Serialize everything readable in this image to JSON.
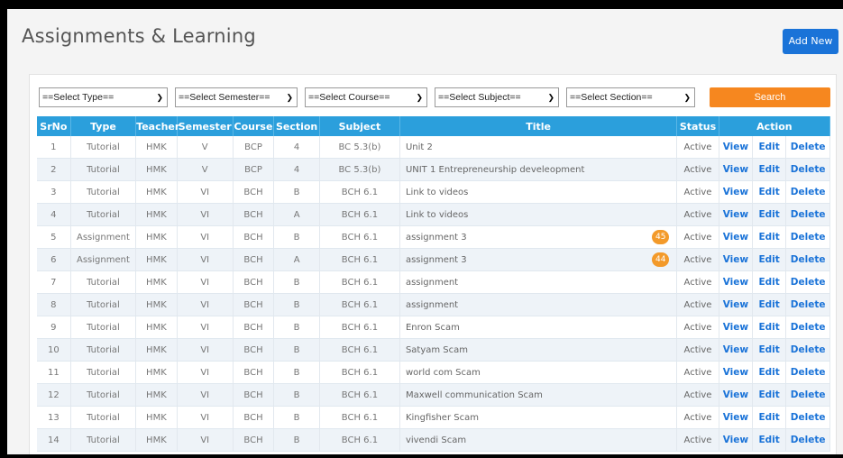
{
  "header": {
    "title": "Assignments & Learning",
    "add_new_label": "Add New"
  },
  "filters": {
    "type": "==Select Type==",
    "semester": "==Select Semester==",
    "course": "==Select Course==",
    "subject": "==Select Subject==",
    "section": "==Select Section==",
    "search_label": "Search"
  },
  "table": {
    "columns": [
      "SrNo",
      "Type",
      "Teacher",
      "Semester",
      "Course",
      "Section",
      "Subject",
      "Title",
      "Status",
      "Action"
    ],
    "actions": {
      "view": "View",
      "edit": "Edit",
      "delete": "Delete"
    },
    "rows": [
      {
        "srno": "1",
        "type": "Tutorial",
        "teacher": "HMK",
        "semester": "V",
        "course": "BCP",
        "section": "4",
        "subject": "BC 5.3(b)",
        "title": "Unit 2",
        "badge": "",
        "status": "Active"
      },
      {
        "srno": "2",
        "type": "Tutorial",
        "teacher": "HMK",
        "semester": "V",
        "course": "BCP",
        "section": "4",
        "subject": "BC 5.3(b)",
        "title": "UNIT 1 Entrepreneurship develeopment",
        "badge": "",
        "status": "Active"
      },
      {
        "srno": "3",
        "type": "Tutorial",
        "teacher": "HMK",
        "semester": "VI",
        "course": "BCH",
        "section": "B",
        "subject": "BCH 6.1",
        "title": "Link to videos",
        "badge": "",
        "status": "Active"
      },
      {
        "srno": "4",
        "type": "Tutorial",
        "teacher": "HMK",
        "semester": "VI",
        "course": "BCH",
        "section": "A",
        "subject": "BCH 6.1",
        "title": "Link to videos",
        "badge": "",
        "status": "Active"
      },
      {
        "srno": "5",
        "type": "Assignment",
        "teacher": "HMK",
        "semester": "VI",
        "course": "BCH",
        "section": "B",
        "subject": "BCH 6.1",
        "title": "assignment 3",
        "badge": "45",
        "status": "Active"
      },
      {
        "srno": "6",
        "type": "Assignment",
        "teacher": "HMK",
        "semester": "VI",
        "course": "BCH",
        "section": "A",
        "subject": "BCH 6.1",
        "title": "assignment 3",
        "badge": "44",
        "status": "Active"
      },
      {
        "srno": "7",
        "type": "Tutorial",
        "teacher": "HMK",
        "semester": "VI",
        "course": "BCH",
        "section": "B",
        "subject": "BCH 6.1",
        "title": "assignment",
        "badge": "",
        "status": "Active"
      },
      {
        "srno": "8",
        "type": "Tutorial",
        "teacher": "HMK",
        "semester": "VI",
        "course": "BCH",
        "section": "B",
        "subject": "BCH 6.1",
        "title": "assignment",
        "badge": "",
        "status": "Active"
      },
      {
        "srno": "9",
        "type": "Tutorial",
        "teacher": "HMK",
        "semester": "VI",
        "course": "BCH",
        "section": "B",
        "subject": "BCH 6.1",
        "title": "Enron Scam",
        "badge": "",
        "status": "Active"
      },
      {
        "srno": "10",
        "type": "Tutorial",
        "teacher": "HMK",
        "semester": "VI",
        "course": "BCH",
        "section": "B",
        "subject": "BCH 6.1",
        "title": "Satyam Scam",
        "badge": "",
        "status": "Active"
      },
      {
        "srno": "11",
        "type": "Tutorial",
        "teacher": "HMK",
        "semester": "VI",
        "course": "BCH",
        "section": "B",
        "subject": "BCH 6.1",
        "title": "world com Scam",
        "badge": "",
        "status": "Active"
      },
      {
        "srno": "12",
        "type": "Tutorial",
        "teacher": "HMK",
        "semester": "VI",
        "course": "BCH",
        "section": "B",
        "subject": "BCH 6.1",
        "title": "Maxwell communication Scam",
        "badge": "",
        "status": "Active"
      },
      {
        "srno": "13",
        "type": "Tutorial",
        "teacher": "HMK",
        "semester": "VI",
        "course": "BCH",
        "section": "B",
        "subject": "BCH 6.1",
        "title": "Kingfisher Scam",
        "badge": "",
        "status": "Active"
      },
      {
        "srno": "14",
        "type": "Tutorial",
        "teacher": "HMK",
        "semester": "VI",
        "course": "BCH",
        "section": "B",
        "subject": "BCH 6.1",
        "title": "vivendi Scam",
        "badge": "",
        "status": "Active"
      }
    ]
  },
  "colors": {
    "header_bg": "#2b9fdc",
    "link": "#1a73d8",
    "search": "#f6871f",
    "badge": "#f39a2a"
  }
}
